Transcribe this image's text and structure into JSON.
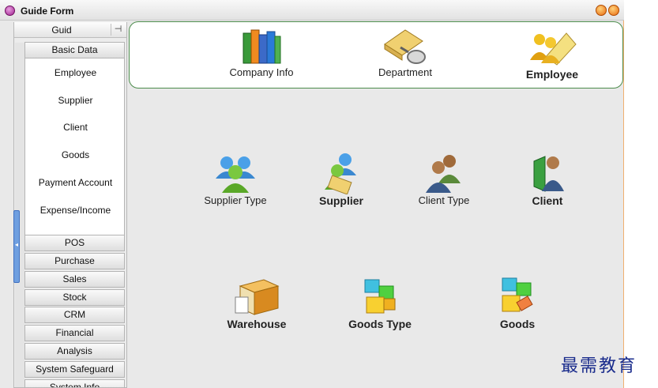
{
  "window": {
    "title": "Guide Form"
  },
  "sidebar": {
    "header": "Guid",
    "pin_icon": "pin-icon",
    "groups_top": [
      {
        "label": "Basic Data"
      }
    ],
    "basic_items": [
      {
        "label": "Employee"
      },
      {
        "label": "Supplier"
      },
      {
        "label": "Client"
      },
      {
        "label": "Goods"
      },
      {
        "label": "Payment Account"
      },
      {
        "label": "Expense/Income"
      }
    ],
    "groups": [
      {
        "label": "POS"
      },
      {
        "label": "Purchase"
      },
      {
        "label": "Sales"
      },
      {
        "label": "Stock"
      },
      {
        "label": "CRM"
      },
      {
        "label": "Financial"
      },
      {
        "label": "Analysis"
      },
      {
        "label": "System Safeguard"
      },
      {
        "label": "System Info"
      }
    ]
  },
  "main": {
    "top_tiles": [
      {
        "label": "Company Info",
        "icon": "books-icon"
      },
      {
        "label": "Department",
        "icon": "book-magnifier-icon"
      },
      {
        "label": "Employee",
        "icon": "people-book-icon"
      }
    ],
    "mid_tiles": [
      {
        "label": "Supplier Type",
        "icon": "people-group-icon"
      },
      {
        "label": "Supplier",
        "icon": "supplier-people-icon"
      },
      {
        "label": "Client Type",
        "icon": "two-persons-icon"
      },
      {
        "label": "Client",
        "icon": "person-door-icon"
      }
    ],
    "bottom_tiles": [
      {
        "label": "Warehouse",
        "icon": "warehouse-icon"
      },
      {
        "label": "Goods Type",
        "icon": "cubes-icon"
      },
      {
        "label": "Goods",
        "icon": "cubes-tag-icon"
      }
    ]
  },
  "watermark": "最需教育"
}
